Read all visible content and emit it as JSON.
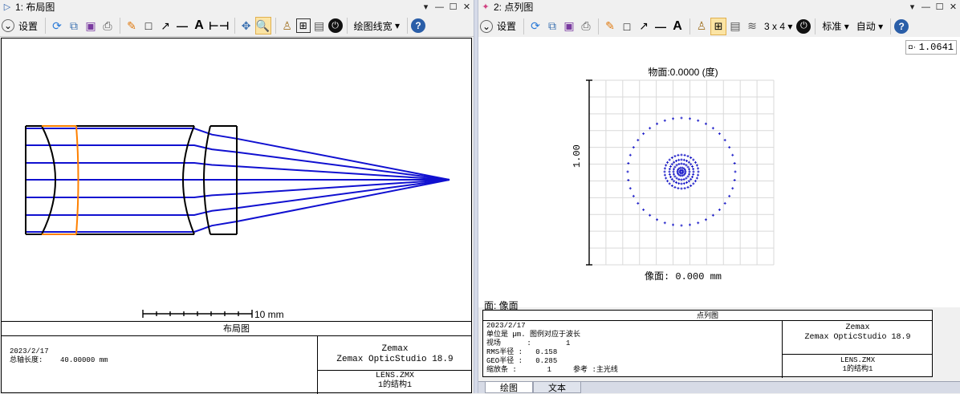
{
  "left": {
    "title": "1: 布局图",
    "toolbar": {
      "settings_label": "设置",
      "line_width_label": "绘图线宽"
    },
    "scale_label": "10 mm",
    "footer": {
      "caption": "布局图",
      "date": "2023/2/17",
      "total_length_label": "总轴长度:",
      "total_length_value": "40.00000 mm",
      "vendor": "Zemax",
      "product": "Zemax OpticStudio 18.9",
      "file": "LENS.ZMX",
      "config": "1的结构1"
    }
  },
  "right": {
    "title": "2: 点列图",
    "toolbar": {
      "settings_label": "设置",
      "grid_label": "3 x 4",
      "standard_label": "标准",
      "auto_label": "自动"
    },
    "zoom_value": "1.0641",
    "object_label": "物面:0.0000 (度)",
    "image_label": "像面: 0.000 mm",
    "yaxis_label": "1.00",
    "surface_label": "面: 像面",
    "footer": {
      "caption": "点列图",
      "date": "2023/2/17",
      "units_line": "单位是 µm. 图例对应于波长",
      "field_label": "视场",
      "field_value": "1",
      "rms_label": "RMS半径 :",
      "rms_value": "0.158",
      "geo_label": "GEO半径 :",
      "geo_value": "0.285",
      "scale_label": "缩放条 :",
      "scale_value": "1",
      "ref_label": "参考 :主光线",
      "vendor": "Zemax",
      "product": "Zemax OpticStudio 18.9",
      "file": "LENS.ZMX",
      "config": "1的结构1"
    },
    "tabs": [
      "绘图",
      "文本"
    ]
  },
  "colors": {
    "ray": "#1010d0",
    "lens": "#000000",
    "lens_alt": "#ff8000",
    "spot": "#1a1ac8",
    "active_button": "#fbe4a4"
  }
}
